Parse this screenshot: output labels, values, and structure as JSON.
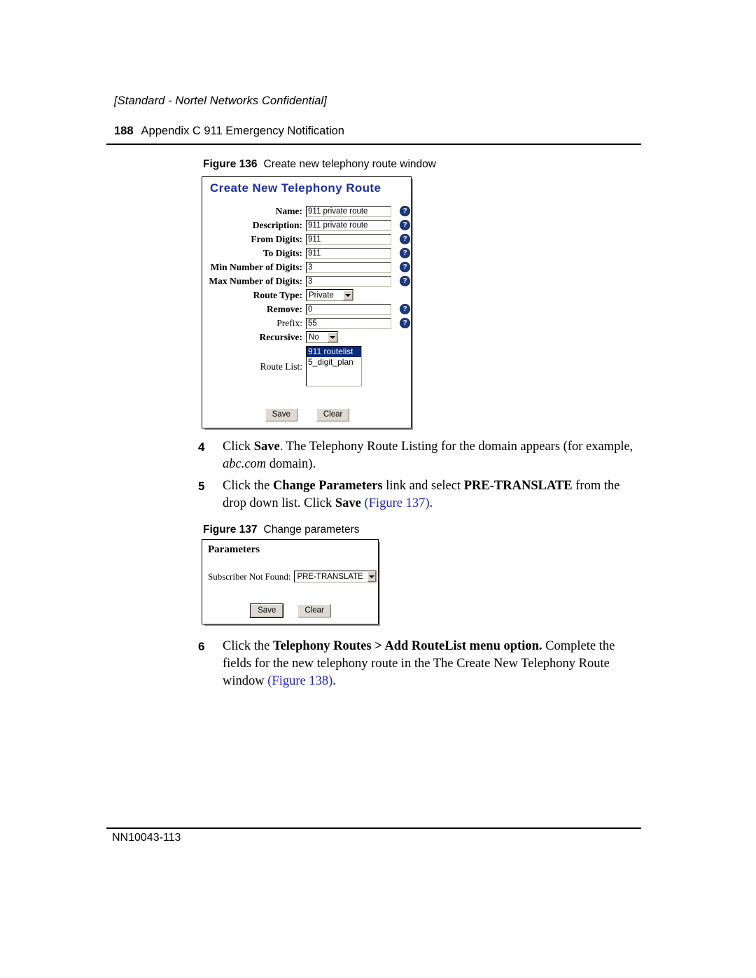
{
  "page": {
    "confidential_notice": "[Standard - Nortel Networks Confidential]",
    "page_number": "188",
    "chapter_title": "Appendix C  911 Emergency Notification",
    "footer_doc_id": "NN10043-113"
  },
  "figure136": {
    "caption_num": "Figure 136",
    "caption_text": "Create new telephony route window",
    "dialog": {
      "title": "Create New Telephony Route",
      "fields": [
        {
          "label": "Name:",
          "value": "911 private route",
          "type": "text",
          "help": "?"
        },
        {
          "label": "Description:",
          "value": "911 private route",
          "type": "text",
          "help": "?"
        },
        {
          "label": "From Digits:",
          "value": "911",
          "type": "text",
          "help": "?"
        },
        {
          "label": "To Digits:",
          "value": "911",
          "type": "text",
          "help": "?"
        },
        {
          "label": "Min Number of Digits:",
          "value": "3",
          "type": "text",
          "help": "?"
        },
        {
          "label": "Max Number of Digits:",
          "value": "3",
          "type": "text",
          "help": "?"
        },
        {
          "label": "Route Type:",
          "value": "Private",
          "type": "select"
        },
        {
          "label": "Remove:",
          "value": "0",
          "type": "text",
          "help": "?"
        },
        {
          "label": "Prefix:",
          "value": "55",
          "type": "text",
          "help": "?"
        },
        {
          "label": "Recursive:",
          "value": "No",
          "type": "select"
        }
      ],
      "route_list_label": "Route List:",
      "route_list_options": [
        {
          "label": "911 routelist",
          "selected": true
        },
        {
          "label": "5_digit_plan",
          "selected": false
        }
      ],
      "save_label": "Save",
      "clear_label": "Clear"
    }
  },
  "figure137": {
    "caption_num": "Figure 137",
    "caption_text": "Change parameters",
    "dialog": {
      "title": "Parameters",
      "field_label": "Subscriber Not Found:",
      "field_value": "PRE-TRANSLATE",
      "save_label": "Save",
      "clear_label": "Clear"
    }
  },
  "steps": {
    "step4": {
      "number": "4",
      "html": "Click <b>Save</b>. The Telephony Route Listing for the domain appears (for example, <i>abc.com</i> domain)."
    },
    "step5": {
      "number": "5",
      "html": "Click the <b>Change Parameters</b> link and select <b>PRE-TRANSLATE</b> from the drop down list. Click <b>Save</b> <span class=\"xref\">(Figure 137)</span>."
    },
    "step6": {
      "number": "6",
      "html": "Click the <b>Telephony Routes &gt; Add RouteList menu option.</b> Complete the fields for the new telephony route in the The Create New Telephony Route window <span class=\"xref\">(Figure 138)</span>."
    }
  },
  "colors": {
    "dialog_title_blue": "#1a2ea8",
    "xref_blue": "#2222cc",
    "listbox_selected_bg": "#0a2a7a",
    "help_icon_bg": "#1b3a85"
  }
}
